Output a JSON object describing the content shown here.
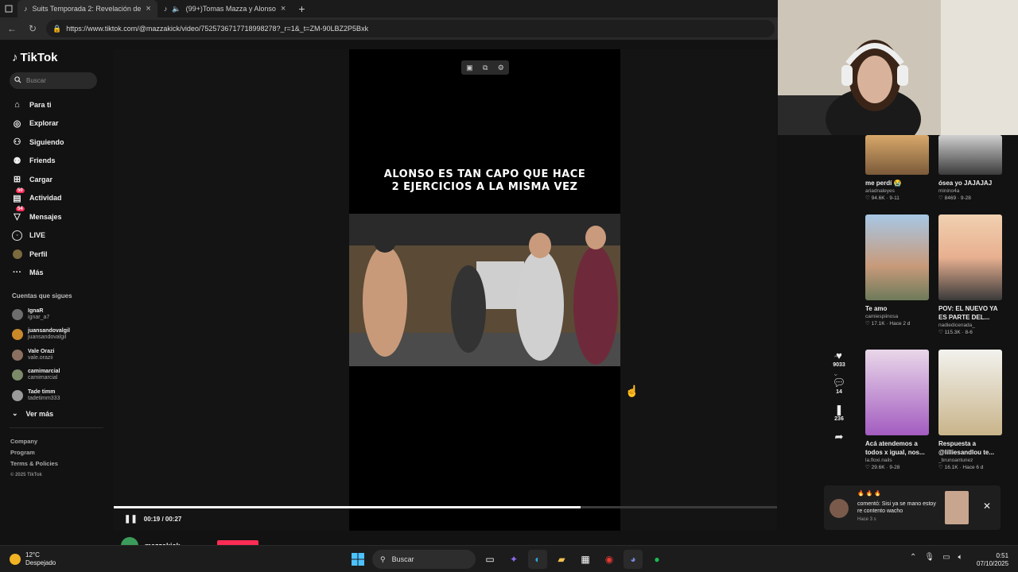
{
  "browser": {
    "tabs": [
      {
        "label": "Suits Temporada 2: Revelación de"
      },
      {
        "label": "(99+)Tomas Mazza y Alonso"
      }
    ],
    "url": "https://www.tiktok.com/@mazzakick/video/7525736717718998278?_r=1&_t=ZM-90LBZ2P5Bxk"
  },
  "sidebar": {
    "logo": "TikTok",
    "search_placeholder": "Buscar",
    "nav": [
      {
        "label": "Para ti",
        "icon": "home-icon"
      },
      {
        "label": "Explorar",
        "icon": "compass-icon"
      },
      {
        "label": "Siguiendo",
        "icon": "following-icon"
      },
      {
        "label": "Friends",
        "icon": "friends-icon"
      },
      {
        "label": "Cargar",
        "icon": "upload-icon"
      },
      {
        "label": "Actividad",
        "icon": "activity-icon",
        "badge": "50"
      },
      {
        "label": "Mensajes",
        "icon": "messages-icon",
        "badge": "54"
      },
      {
        "label": "LIVE",
        "icon": "live-icon"
      },
      {
        "label": "Perfil",
        "icon": "profile-icon"
      },
      {
        "label": "Más",
        "icon": "more-icon"
      }
    ],
    "following_title": "Cuentas que sigues",
    "following": [
      {
        "name": "IgnaR",
        "handle": "ignar_a7"
      },
      {
        "name": "juansandovalgil",
        "handle": "juansandovalgil"
      },
      {
        "name": "Vale Orazi",
        "handle": "vale.orazii"
      },
      {
        "name": "camimarcial",
        "handle": "camimarcial"
      },
      {
        "name": "Tade timm",
        "handle": "tadetimm333"
      }
    ],
    "ver_mas": "Ver más",
    "footer": [
      "Company",
      "Program",
      "Terms & Policies"
    ],
    "copyright": "© 2025 TikTok"
  },
  "video": {
    "caption_line1": "ALONSO ES TAN CAPO QUE HACE",
    "caption_line2": "2 EJERCICIOS A LA MISMA VEZ",
    "time": "00:19 / 00:27",
    "progress": 0.7037,
    "author": "mazzakick"
  },
  "actions": {
    "likes": "9033",
    "comments": "14",
    "saves": "236"
  },
  "recommended": [
    {
      "title": "me perdí 😭",
      "user": "ariadnaleyes",
      "meta": "♡ 94.6K · 9-11"
    },
    {
      "title": "ósea yo JAJAJAJ",
      "user": "minino4a",
      "meta": "♡ 8469 · 9-28"
    },
    {
      "title": "Te amo",
      "user": "camiespiinosa",
      "meta": "♡ 17.1K · Hace 2 d"
    },
    {
      "title": "POV: EL NUEVO YA ES PARTE DEL...",
      "user": "nadiedicenada_",
      "meta": "♡ 115.3K · 8-6"
    },
    {
      "title": "Acá atendemos a todos x igual, nos...",
      "user": "la.floxi.nails",
      "meta": "♡ 29.6K · 9-28"
    },
    {
      "title": "Respuesta a @lilliesandlou te...",
      "user": "_brunoantunez",
      "meta": "♡ 16.1K · Hace 6 d"
    }
  ],
  "notification": {
    "emoji": "🔥 🔥 🔥",
    "message": "comentó: Sisi ya se mano estoy re contento wacho",
    "ago": "Hace 3 s"
  },
  "taskbar": {
    "temp": "12°C",
    "weather": "Despejado",
    "search": "Buscar",
    "time": "0:51",
    "date": "07/10/2025"
  }
}
